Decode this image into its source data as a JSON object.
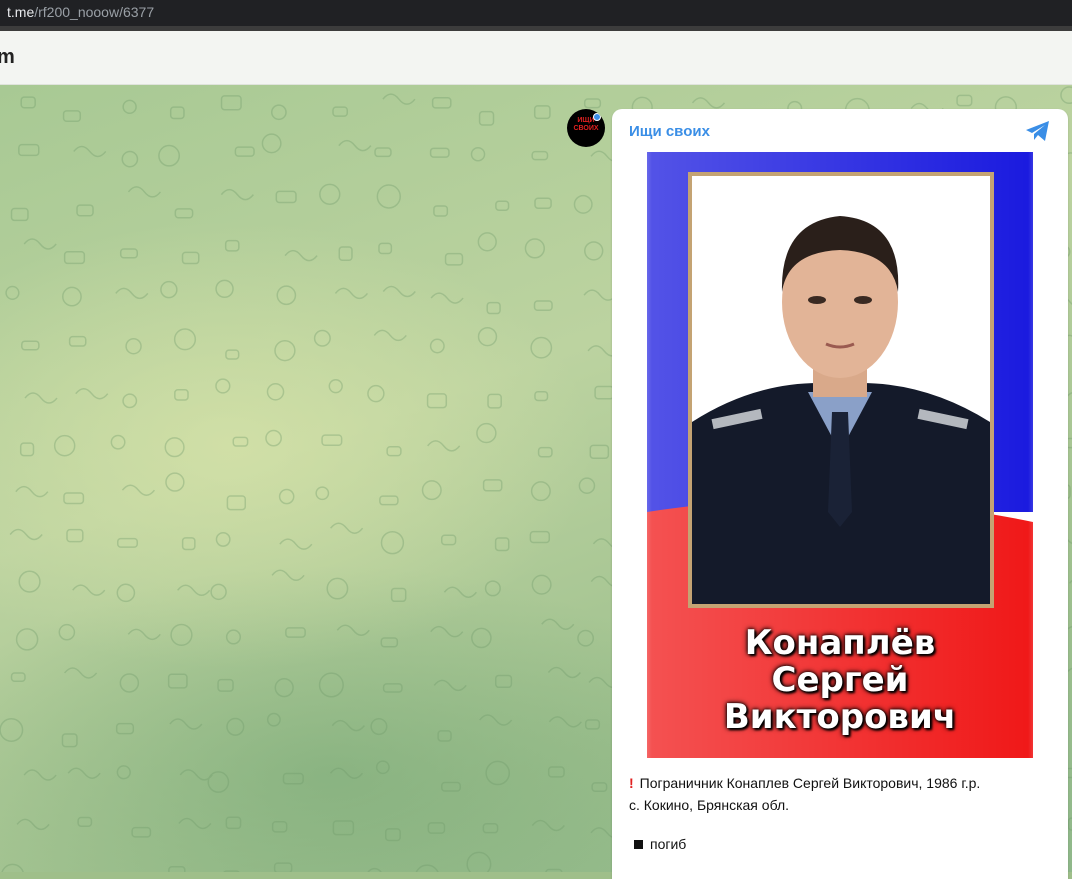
{
  "browser": {
    "url_host": "t.me",
    "url_path": "/rf200_nooow/6377"
  },
  "header": {
    "brand_fragment": "m"
  },
  "channel": {
    "name": "Ищи своих",
    "avatar_text": "ИЩИ\nСВОИХ"
  },
  "post": {
    "photo_name_lines": [
      "Конаплёв",
      "Сергей",
      "Викторович"
    ],
    "caption_line1": "Пограничник Конаплев Сергей Викторович, 1986 г.р.",
    "caption_line2": "с. Кокино, Брянская обл.",
    "status": "погиб"
  },
  "colors": {
    "link": "#3a8ee6",
    "accent_red": "#e02020",
    "flag_blue": "#1a1adf",
    "flag_red": "#f01818"
  }
}
